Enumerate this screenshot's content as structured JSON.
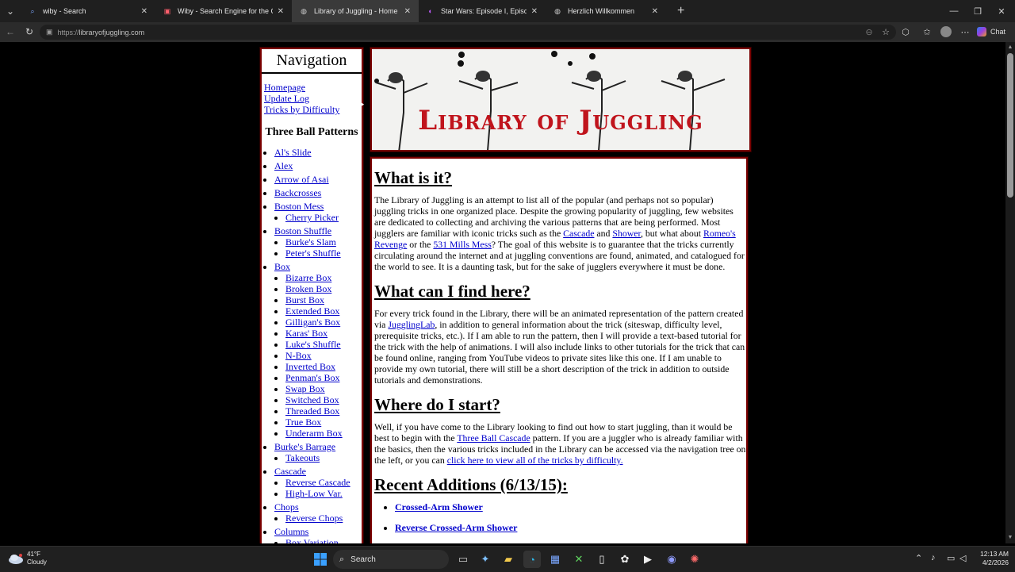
{
  "browser": {
    "tabs": [
      {
        "title": "wiby - Search",
        "active": false,
        "icon": "search-icon"
      },
      {
        "title": "Wiby - Search Engine for the Classic Web",
        "active": false,
        "icon": "wiby-icon"
      },
      {
        "title": "Library of Juggling - Home",
        "active": true,
        "icon": "globe-icon"
      },
      {
        "title": "Star Wars: Episode I, Episode II, Episode III",
        "active": false,
        "icon": "starwars-icon"
      },
      {
        "title": "Herzlich Willkommen",
        "active": false,
        "icon": "globe-icon"
      }
    ],
    "url_prefix": "https://",
    "url_host": "libraryofjuggling.com",
    "chat_label": "Chat"
  },
  "nav": {
    "heading": "Navigation",
    "links": [
      "Homepage",
      "Update Log",
      "Tricks by Difficulty"
    ],
    "section_title": "Three Ball Patterns",
    "tree": [
      {
        "label": "Al's Slide",
        "children": []
      },
      {
        "label": "Alex",
        "children": []
      },
      {
        "label": "Arrow of Asai",
        "children": []
      },
      {
        "label": "Backcrosses",
        "children": []
      },
      {
        "label": "Boston Mess",
        "children": [
          "Cherry Picker"
        ]
      },
      {
        "label": "Boston Shuffle",
        "children": [
          "Burke's Slam",
          "Peter's Shuffle"
        ]
      },
      {
        "label": "Box",
        "children": [
          "Bizarre Box",
          "Broken Box",
          "Burst Box",
          "Extended Box",
          "Gilligan's Box",
          "Karas' Box",
          "Luke's Shuffle",
          "N-Box",
          "Inverted Box",
          "Penman's Box",
          "Swap Box",
          "Switched Box",
          "Threaded Box",
          "True Box",
          "Underarm Box"
        ]
      },
      {
        "label": "Burke's Barrage",
        "children": [
          "Takeouts"
        ]
      },
      {
        "label": "Cascade",
        "children": [
          "Reverse Cascade",
          "High-Low Var."
        ]
      },
      {
        "label": "Chops",
        "children": [
          "Reverse Chops"
        ]
      },
      {
        "label": "Columns",
        "children": [
          "Box Variation"
        ]
      }
    ]
  },
  "banner": {
    "title": "Library of Juggling"
  },
  "main": {
    "h_what": "What is it?",
    "p1_a": "The Library of Juggling is an attempt to list all of the popular (and perhaps not so popular) juggling tricks in one organized place. Despite the growing popularity of juggling, few websites are dedicated to collecting and archiving the various patterns that are being performed. Most jugglers are familiar with iconic tricks such as the ",
    "p1_link1": "Cascade",
    "p1_b": " and ",
    "p1_link2": "Shower",
    "p1_c": ", but what about ",
    "p1_link3": "Romeo's Revenge",
    "p1_d": " or the ",
    "p1_link4": "531 Mills Mess",
    "p1_e": "? The goal of this website is to guarantee that the tricks currently circulating around the internet and at juggling conventions are found, animated, and catalogued for the world to see. It is a daunting task, but for the sake of jugglers everywhere it must be done.",
    "h_find": "What can I find here?",
    "p2_a": "For every trick found in the Library, there will be an animated representation of the pattern created via ",
    "p2_link": "JugglingLab",
    "p2_b": ", in addition to general information about the trick (siteswap, difficulty level, prerequisite tricks, etc.). If I am able to run the pattern, then I will provide a text-based tutorial for the trick with the help of animations. I will also include links to other tutorials for the trick that can be found online, ranging from YouTube videos to private sites like this one. If I am unable to provide my own tutorial, there will still be a short description of the trick in addition to outside tutorials and demonstrations.",
    "h_start": "Where do I start?",
    "p3_a": "Well, if you have come to the Library looking to find out how to start juggling, than it would be best to begin with the ",
    "p3_link1": "Three Ball Cascade",
    "p3_b": " pattern. If you are a juggler who is already familiar with the basics, then the various tricks included in the Library can be accessed via the navigation tree on the left, or you can ",
    "p3_link2": "click here to view all of the tricks by difficulty.",
    "h_recent": "Recent Additions (6/13/15):",
    "recent": [
      "Crossed-Arm Shower",
      "Reverse Crossed-Arm Shower"
    ]
  },
  "taskbar": {
    "temp": "41°F",
    "condition": "Cloudy",
    "search_label": "Search",
    "time": "12:13 AM",
    "date": "4/2/2026"
  }
}
